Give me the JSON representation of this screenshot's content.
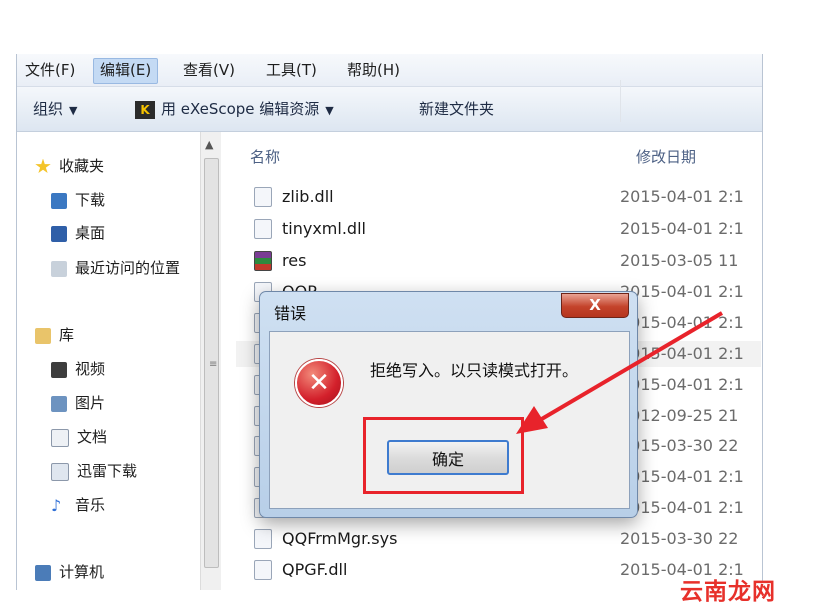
{
  "menu": [
    "文件(F)",
    "编辑(E)",
    "查看(V)",
    "工具(T)",
    "帮助(H)"
  ],
  "toolbar": {
    "organize": "组织",
    "exescope": "用 eXeScope 编辑资源",
    "new_folder": "新建文件夹"
  },
  "nav": {
    "favorites": "收藏夹",
    "downloads": "下载",
    "desktop": "桌面",
    "recent": "最近访问的位置",
    "libraries": "库",
    "videos": "视频",
    "pictures": "图片",
    "documents": "文档",
    "thunder": "迅雷下载",
    "music": "音乐",
    "computer": "计算机"
  },
  "columns": {
    "name": "名称",
    "modified": "修改日期"
  },
  "files": [
    {
      "name": "zlib.dll",
      "date": "2015-04-01 2:1"
    },
    {
      "name": "tinyxml.dll",
      "date": "2015-04-01 2:1"
    },
    {
      "name": "res",
      "date": "2015-03-05 11"
    },
    {
      "name": "QQP...",
      "date": "2015-04-01 2:1"
    },
    {
      "name": "",
      "date": "2015-04-01 2:1"
    },
    {
      "name": "",
      "date": "2015-04-01 2:1"
    },
    {
      "name": "",
      "date": "2015-04-01 2:1"
    },
    {
      "name": "",
      "date": "2012-09-25 21"
    },
    {
      "name": "",
      "date": "2015-03-30 22"
    },
    {
      "name": "",
      "date": "2015-04-01 2:1"
    },
    {
      "name": "",
      "date": "2015-04-01 2:1"
    },
    {
      "name": "QQFrmMgr.sys",
      "date": "2015-03-30 22"
    },
    {
      "name": "QPGF.dll",
      "date": "2015-04-01 2:1"
    }
  ],
  "dialog": {
    "title": "错误",
    "close": "X",
    "message": "拒绝写入。以只读模式打开。",
    "ok": "确定"
  },
  "watermark": "云南龙网",
  "colors": {
    "annotation": "#e8232b",
    "accent": "#3e7bcf"
  }
}
